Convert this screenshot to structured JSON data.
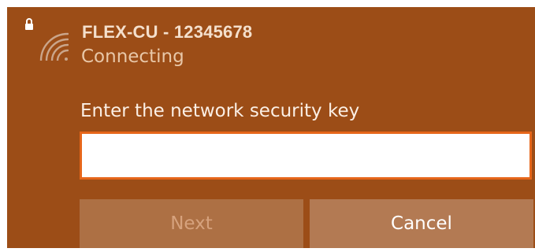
{
  "colors": {
    "panel_background": "#9c4d17",
    "input_border": "#e6661a",
    "next_button_bg": "#ad7044",
    "cancel_button_bg": "#b37a53"
  },
  "network": {
    "icon": "wifi-secured-icon",
    "ssid": "FLEX-CU - 12345678",
    "status": "Connecting"
  },
  "security_key": {
    "label": "Enter the network security key",
    "value": ""
  },
  "buttons": {
    "next_label": "Next",
    "next_enabled": false,
    "cancel_label": "Cancel"
  }
}
